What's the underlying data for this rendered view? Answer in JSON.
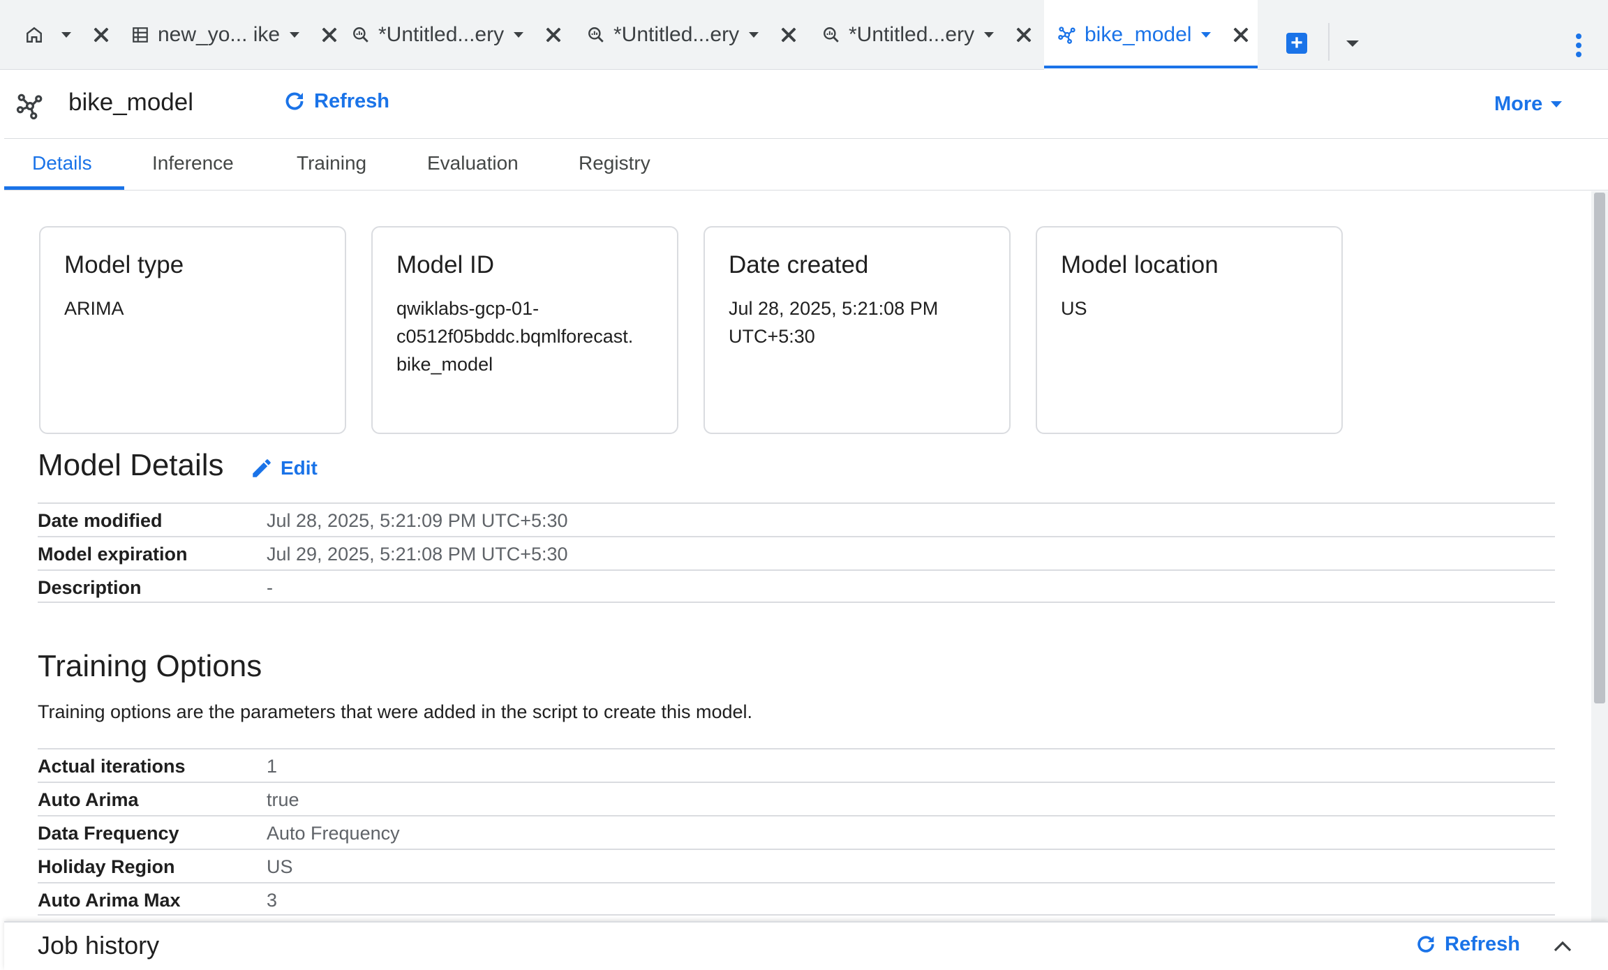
{
  "tabs": [
    {
      "label": "",
      "icon": "home-icon"
    },
    {
      "label": "new_yo... ike",
      "icon": "table-icon"
    },
    {
      "label": "*Untitled...ery",
      "icon": "query-icon"
    },
    {
      "label": "*Untitled...ery",
      "icon": "query-icon"
    },
    {
      "label": "*Untitled...ery",
      "icon": "query-icon"
    },
    {
      "label": "bike_model",
      "icon": "model-icon",
      "active": true
    }
  ],
  "header": {
    "title": "bike_model",
    "refresh_label": "Refresh",
    "more_label": "More"
  },
  "subtabs": [
    "Details",
    "Inference",
    "Training",
    "Evaluation",
    "Registry"
  ],
  "cards": [
    {
      "title": "Model type",
      "value": "ARIMA"
    },
    {
      "title": "Model ID",
      "value_lines": [
        "qwiklabs-gcp-01-",
        "c0512f05bddc.bqmlforecast.",
        "bike_model"
      ]
    },
    {
      "title": "Date created",
      "value_lines": [
        "Jul 28, 2025, 5:21:08 PM",
        "UTC+5:30"
      ]
    },
    {
      "title": "Model location",
      "value": "US"
    }
  ],
  "model_details": {
    "title": "Model Details",
    "edit_label": "Edit",
    "rows": [
      {
        "key": "Date modified",
        "value": "Jul 28, 2025, 5:21:09 PM UTC+5:30"
      },
      {
        "key": "Model expiration",
        "value": "Jul 29, 2025, 5:21:08 PM UTC+5:30"
      },
      {
        "key": "Description",
        "value": "-"
      }
    ]
  },
  "training_options": {
    "title": "Training Options",
    "description": "Training options are the parameters that were added in the script to create this model.",
    "rows": [
      {
        "key": "Actual iterations",
        "value": "1"
      },
      {
        "key": "Auto Arima",
        "value": "true"
      },
      {
        "key": "Data Frequency",
        "value": "Auto Frequency"
      },
      {
        "key": "Holiday Region",
        "value": "US"
      },
      {
        "key": "Auto Arima Max",
        "value": "3"
      }
    ]
  },
  "job_history": {
    "title": "Job history",
    "refresh_label": "Refresh"
  },
  "colors": {
    "accent": "#1a73e8",
    "border": "#dadce0"
  }
}
